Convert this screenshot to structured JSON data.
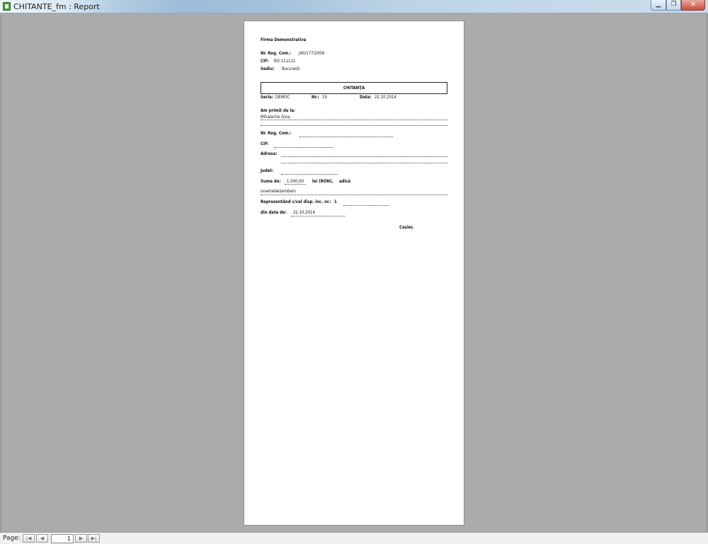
{
  "window": {
    "title": "CHITANTE_fm : Report"
  },
  "report": {
    "company_name": "Firma Demonstrativa",
    "reg_com_label": "Nr. Reg. Com.:",
    "reg_com_value": "J40/177/2009",
    "cif_label": "CIF:",
    "cif_value": "RO 111111",
    "sediu_label": "Sediu:",
    "sediu_value": "Bucuresti",
    "doc_title": "CHITANŢA",
    "seria_label": "Seria:",
    "seria_value": "DEMOC",
    "nr_label": "Nr.:",
    "nr_value": "19",
    "data_label": "Data:",
    "data_value": "22.10.2014",
    "primit_label": "Am primit de la:",
    "primit_value": "Mihalache Gina",
    "client_reg_label": "Nr. Reg. Com.:",
    "client_cif_label": "CIF:",
    "adresa_label": "Adresa:",
    "judet_label": "Judet:",
    "suma_label": "Suma de:",
    "suma_value": "1.000,00",
    "lei_label": "lei (RON),",
    "adica_label": "adică",
    "suma_litere": "unamieleizerobani",
    "reprezentand_label": "Reprezentând c/val disp. inc. nr.:",
    "reprezentand_value": "1",
    "din_data_label": "din data de:",
    "din_data_value": "22.10.2014",
    "casier_label": "Casier,"
  },
  "statusbar": {
    "page_label": "Page:",
    "page_number": "1"
  }
}
